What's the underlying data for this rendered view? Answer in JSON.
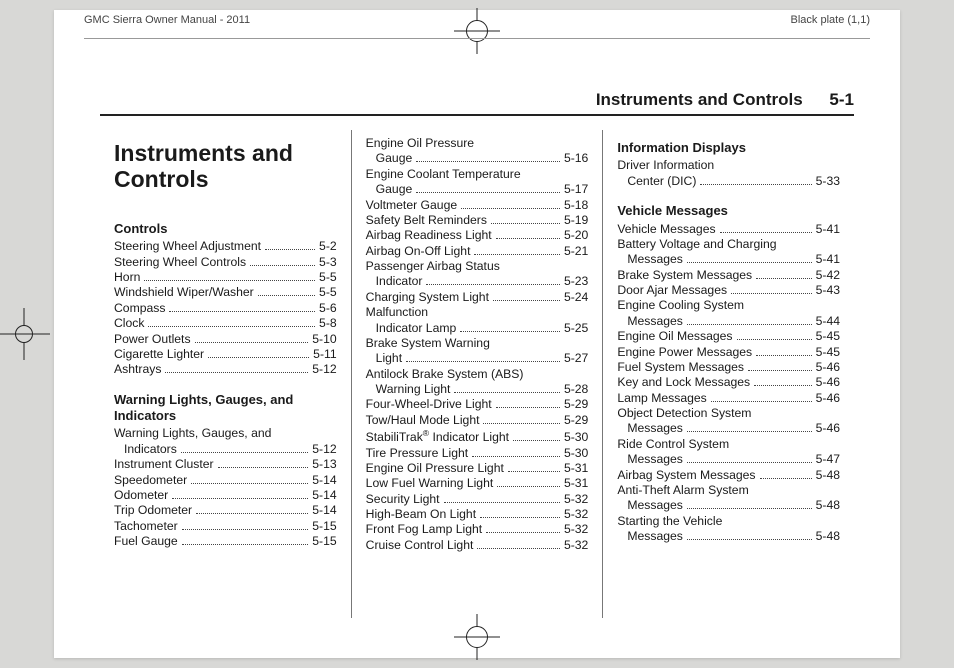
{
  "header": {
    "manual_title": "GMC Sierra Owner Manual - 2011",
    "plate": "Black plate (1,1)"
  },
  "running_head": {
    "section": "Instruments and Controls",
    "page": "5-1"
  },
  "chapter_title": "Instruments and Controls",
  "col1": {
    "groups": [
      {
        "heading": "Controls",
        "items": [
          {
            "label": "Steering Wheel Adjustment",
            "page": "5-2"
          },
          {
            "label": "Steering Wheel Controls",
            "page": "5-3"
          },
          {
            "label": "Horn",
            "page": "5-5"
          },
          {
            "label": "Windshield Wiper/Washer",
            "page": "5-5"
          },
          {
            "label": "Compass",
            "page": "5-6"
          },
          {
            "label": "Clock",
            "page": "5-8"
          },
          {
            "label": "Power Outlets",
            "page": "5-10"
          },
          {
            "label": "Cigarette Lighter",
            "page": "5-11"
          },
          {
            "label": "Ashtrays",
            "page": "5-12"
          }
        ]
      },
      {
        "heading": "Warning Lights, Gauges, and Indicators",
        "items": [
          {
            "label": "Warning Lights, Gauges, and",
            "cont": true
          },
          {
            "label": "Indicators",
            "page": "5-12",
            "indent": true
          },
          {
            "label": "Instrument Cluster",
            "page": "5-13"
          },
          {
            "label": "Speedometer",
            "page": "5-14"
          },
          {
            "label": "Odometer",
            "page": "5-14"
          },
          {
            "label": "Trip Odometer",
            "page": "5-14"
          },
          {
            "label": "Tachometer",
            "page": "5-15"
          },
          {
            "label": "Fuel Gauge",
            "page": "5-15"
          }
        ]
      }
    ]
  },
  "col2": {
    "groups": [
      {
        "items": [
          {
            "label": "Engine Oil Pressure",
            "cont": true
          },
          {
            "label": "Gauge",
            "page": "5-16",
            "indent": true
          },
          {
            "label": "Engine Coolant Temperature",
            "cont": true
          },
          {
            "label": "Gauge",
            "page": "5-17",
            "indent": true
          },
          {
            "label": "Voltmeter Gauge",
            "page": "5-18"
          },
          {
            "label": "Safety Belt Reminders",
            "page": "5-19"
          },
          {
            "label": "Airbag Readiness Light",
            "page": "5-20"
          },
          {
            "label": "Airbag On-Off Light",
            "page": "5-21"
          },
          {
            "label": "Passenger Airbag Status",
            "cont": true
          },
          {
            "label": "Indicator",
            "page": "5-23",
            "indent": true
          },
          {
            "label": "Charging System Light",
            "page": "5-24"
          },
          {
            "label": "Malfunction",
            "cont": true
          },
          {
            "label": "Indicator Lamp",
            "page": "5-25",
            "indent": true
          },
          {
            "label": "Brake System Warning",
            "cont": true
          },
          {
            "label": "Light",
            "page": "5-27",
            "indent": true
          },
          {
            "label": "Antilock Brake System (ABS)",
            "cont": true
          },
          {
            "label": "Warning Light",
            "page": "5-28",
            "indent": true
          },
          {
            "label": "Four-Wheel-Drive Light",
            "page": "5-29"
          },
          {
            "label": "Tow/Haul Mode Light",
            "page": "5-29"
          },
          {
            "label": "StabiliTrak® Indicator Light",
            "page": "5-30"
          },
          {
            "label": "Tire Pressure Light",
            "page": "5-30"
          },
          {
            "label": "Engine Oil Pressure Light",
            "page": "5-31"
          },
          {
            "label": "Low Fuel Warning Light",
            "page": "5-31"
          },
          {
            "label": "Security Light",
            "page": "5-32"
          },
          {
            "label": "High-Beam On Light",
            "page": "5-32"
          },
          {
            "label": "Front Fog Lamp Light",
            "page": "5-32"
          },
          {
            "label": "Cruise Control Light",
            "page": "5-32"
          }
        ]
      }
    ]
  },
  "col3": {
    "groups": [
      {
        "heading": "Information Displays",
        "items": [
          {
            "label": "Driver Information",
            "cont": true
          },
          {
            "label": "Center (DIC)",
            "page": "5-33",
            "indent": true
          }
        ]
      },
      {
        "heading": "Vehicle Messages",
        "items": [
          {
            "label": "Vehicle Messages",
            "page": "5-41"
          },
          {
            "label": "Battery Voltage and Charging",
            "cont": true
          },
          {
            "label": "Messages",
            "page": "5-41",
            "indent": true
          },
          {
            "label": "Brake System Messages",
            "page": "5-42"
          },
          {
            "label": "Door Ajar Messages",
            "page": "5-43"
          },
          {
            "label": "Engine Cooling System",
            "cont": true
          },
          {
            "label": "Messages",
            "page": "5-44",
            "indent": true
          },
          {
            "label": "Engine Oil Messages",
            "page": "5-45"
          },
          {
            "label": "Engine Power Messages",
            "page": "5-45"
          },
          {
            "label": "Fuel System Messages",
            "page": "5-46"
          },
          {
            "label": "Key and Lock Messages",
            "page": "5-46"
          },
          {
            "label": "Lamp Messages",
            "page": "5-46"
          },
          {
            "label": "Object Detection System",
            "cont": true
          },
          {
            "label": "Messages",
            "page": "5-46",
            "indent": true
          },
          {
            "label": "Ride Control System",
            "cont": true
          },
          {
            "label": "Messages",
            "page": "5-47",
            "indent": true
          },
          {
            "label": "Airbag System Messages",
            "page": "5-48"
          },
          {
            "label": "Anti-Theft Alarm System",
            "cont": true
          },
          {
            "label": "Messages",
            "page": "5-48",
            "indent": true
          },
          {
            "label": "Starting the Vehicle",
            "cont": true
          },
          {
            "label": "Messages",
            "page": "5-48",
            "indent": true
          }
        ]
      }
    ]
  }
}
